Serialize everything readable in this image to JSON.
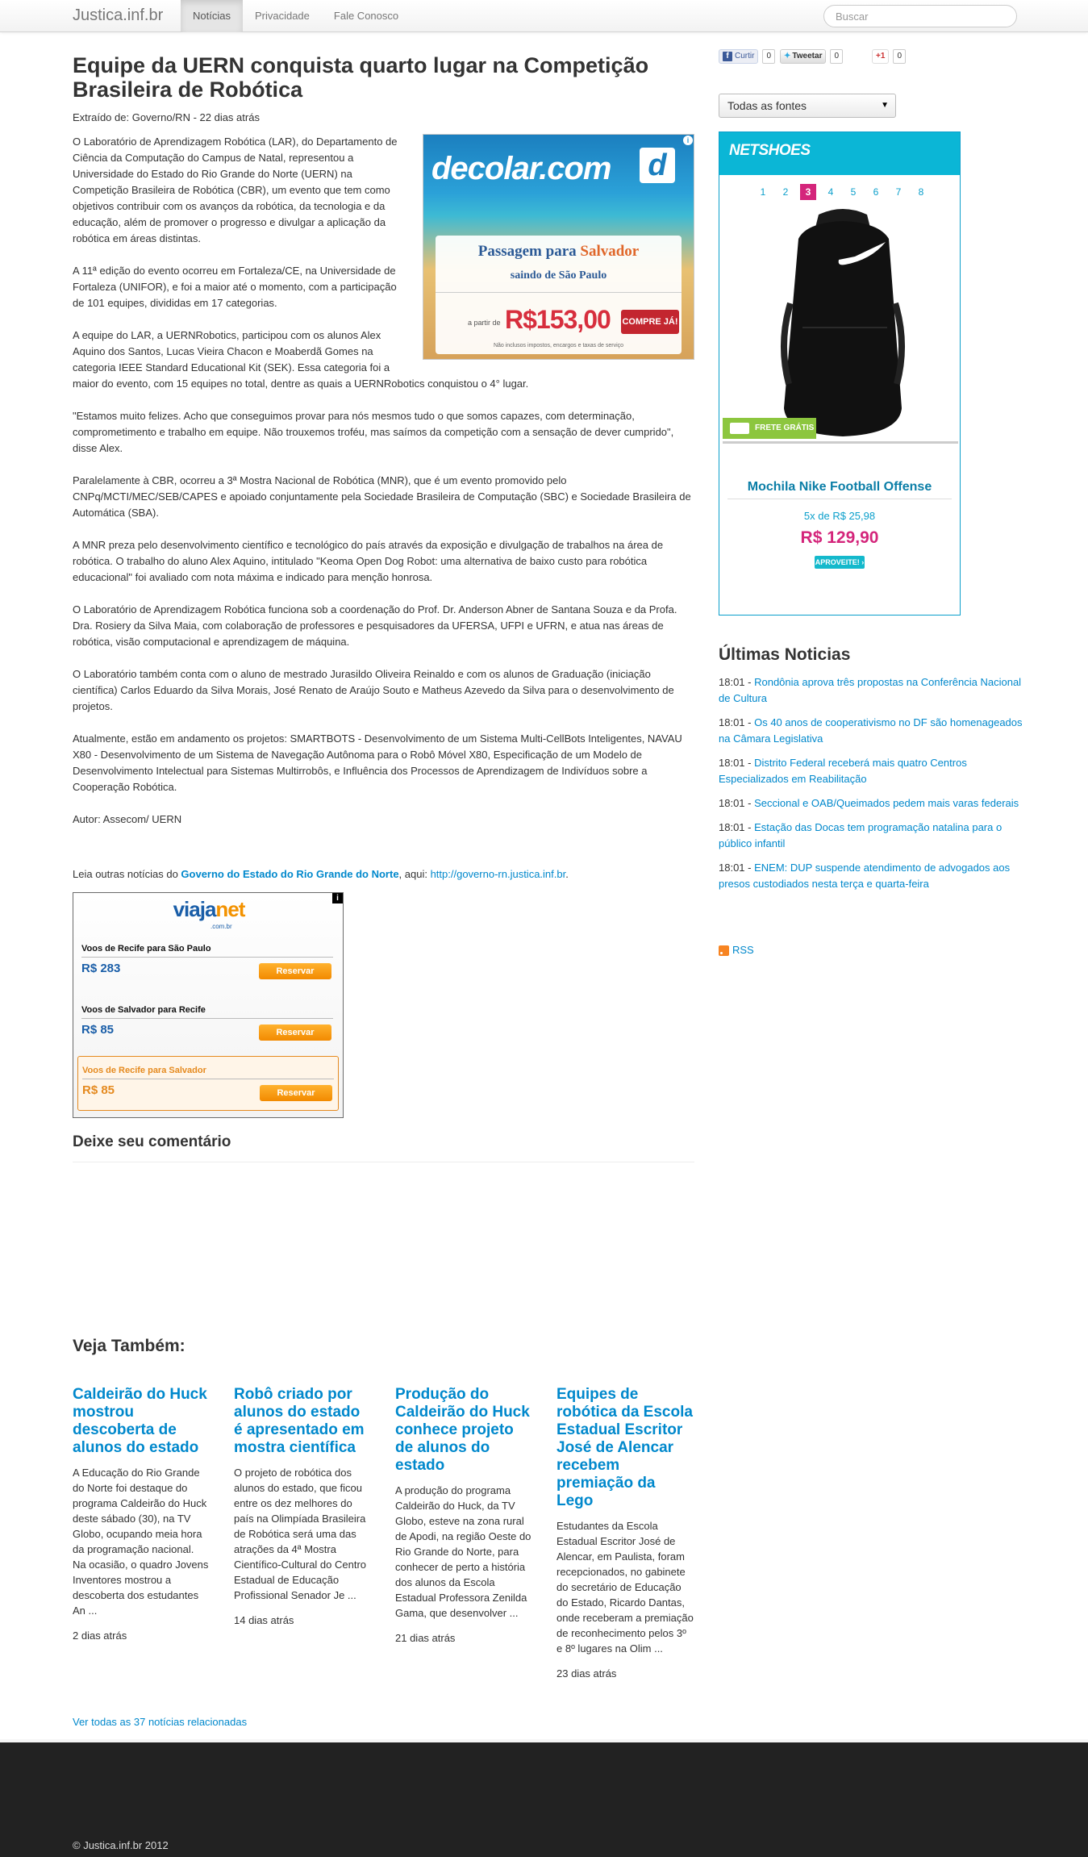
{
  "navbar": {
    "brand": "Justica.inf.br",
    "items": [
      {
        "label": "Notícias"
      },
      {
        "label": "Privacidade"
      },
      {
        "label": "Fale Conosco"
      }
    ],
    "search_placeholder": "Buscar"
  },
  "article": {
    "title": "Equipe da UERN conquista quarto lugar na Competição Brasileira de Robótica",
    "source": "Extraído de: Governo/RN - 22 dias atrás",
    "paragraphs": [
      "O Laboratório de Aprendizagem Robótica (LAR), do Departamento de Ciência da Computação do Campus de Natal, representou a Universidade do Estado do Rio Grande do Norte (UERN) na Competição Brasileira de Robótica (CBR), um evento que tem como objetivos contribuir com os avanços da robótica, da tecnologia e da educação, além de promover o progresso e divulgar a aplicação da robótica em áreas distintas.",
      "A 11ª edição do evento ocorreu em Fortaleza/CE, na Universidade de Fortaleza (UNIFOR), e foi a maior até o momento, com a participação de 101 equipes, divididas em 17 categorias.",
      "A equipe do LAR, a UERNRobotics, participou com os alunos Alex Aquino dos Santos, Lucas Vieira Chacon e Moaberdã Gomes na categoria IEEE Standard Educational Kit (SEK). Essa categoria foi a maior do evento, com 15 equipes no total, dentre as quais a UERNRobotics conquistou o 4° lugar.",
      "\"Estamos muito felizes. Acho que conseguimos provar para nós mesmos tudo o que somos capazes, com determinação, comprometimento e trabalho em equipe. Não trouxemos troféu, mas saímos da competição com a sensação de dever cumprido\", disse Alex.",
      "Paralelamente à CBR, ocorreu a 3ª Mostra Nacional de Robótica (MNR), que é um evento promovido pelo CNPq/MCTI/MEC/SEB/CAPES e apoiado conjuntamente pela Sociedade Brasileira de Computação (SBC) e Sociedade Brasileira de Automática (SBA).",
      "A MNR preza pelo desenvolvimento científico e tecnológico do país através da exposição e divulgação de trabalhos na área de robótica. O trabalho do aluno Alex Aquino, intitulado \"Keoma Open Dog Robot: uma alternativa de baixo custo para robótica educacional\" foi avaliado com nota máxima e indicado para menção honrosa.",
      "O Laboratório de Aprendizagem Robótica funciona sob a coordenação do Prof. Dr. Anderson Abner de Santana Souza e da Profa. Dra. Rosiery da Silva Maia, com colaboração de professores e pesquisadores da UFERSA, UFPI e UFRN, e atua nas áreas de robótica, visão computacional e aprendizagem de máquina.",
      "O Laboratório também conta com o aluno de mestrado Jurasildo Oliveira Reinaldo e com os alunos de Graduação (iniciação científica) Carlos Eduardo da Silva Morais, José Renato de Araújo Souto e Matheus Azevedo da Silva para o desenvolvimento de projetos.",
      "Atualmente, estão em andamento os projetos: SMARTBOTS - Desenvolvimento de um Sistema Multi-CellBots Inteligentes, NAVAU X80 - Desenvolvimento de um Sistema de Navegação Autônoma para o Robô Móvel X80, Especificação de um Modelo de Desenvolvimento Intelectual para Sistemas Multirrobôs, e Influência dos Processos de Aprendizagem de Indivíduos sobre a Cooperação Robótica.",
      "Autor: Assecom/ UERN"
    ],
    "related": {
      "prefix": "Leia outras notícias do ",
      "org": "Governo do Estado do Rio Grande do Norte",
      "middle": ", aqui: ",
      "url": "http://governo-rn.justica.inf.br",
      "suffix": "."
    }
  },
  "ad_decolar": {
    "logo": "decolar.com",
    "info": "i",
    "line1_a": "Passagem para ",
    "line1_b": "Salvador",
    "line2": "saindo de São Paulo",
    "from": "a partir de",
    "price": "R$153,00",
    "button": "COMPRE JÁ!",
    "fine": "Não inclusos impostos, encargos e taxas de serviço"
  },
  "ad_viajanet": {
    "logo_a": "viaja",
    "logo_b": "net",
    "sub": ".com.br",
    "offers": [
      {
        "route": "Voos de Recife para São Paulo",
        "price": "R$ 283",
        "button": "Reservar"
      },
      {
        "route": "Voos de Salvador para Recife",
        "price": "R$ 85",
        "button": "Reservar"
      },
      {
        "route": "Voos de Recife para Salvador",
        "price": "R$ 85",
        "button": "Reservar"
      }
    ]
  },
  "comments": {
    "heading": "Deixe seu comentário"
  },
  "veja": {
    "heading": "Veja Também:",
    "items": [
      {
        "title": "Caldeirão do Huck mostrou descoberta de alunos do estado",
        "text": "A Educação do Rio Grande do Norte foi destaque do programa Caldeirão do Huck deste sábado (30), na TV Globo, ocupando meia hora da programação nacional. Na ocasião, o quadro Jovens Inventores mostrou a descoberta dos estudantes An ...",
        "date": "2 dias atrás"
      },
      {
        "title": "Robô criado por alunos do estado é apresentado em mostra científica",
        "text": "O projeto de robótica dos alunos do estado, que ficou entre os dez melhores do país na Olimpíada Brasileira de Robótica será uma das atrações da 4ª Mostra Científico-Cultural do Centro Estadual de Educação Profissional Senador Je ...",
        "date": "14 dias atrás"
      },
      {
        "title": "Produção do Caldeirão do Huck conhece projeto de alunos do estado",
        "text": "A produção do programa Caldeirão do Huck, da TV Globo, esteve na zona rural de Apodi, na região Oeste do Rio Grande do Norte, para conhecer de perto a história dos alunos da Escola Estadual Professora Zenilda Gama, que desenvolver ...",
        "date": "21 dias atrás"
      },
      {
        "title": "Equipes de robótica da Escola Estadual Escritor José de Alencar recebem premiação da Lego",
        "text": "Estudantes da Escola Estadual Escritor José de Alencar, em Paulista, foram recepcionados, no gabinete do secretário de Educação do Estado, Ricardo Dantas, onde receberam a premiação de reconhecimento pelos 3º e 8º lugares na Olim ...",
        "date": "23 dias atrás"
      }
    ],
    "see_all": "Ver todas as 37 notícias relacionadas"
  },
  "sidebar": {
    "social": {
      "fb_label": "Curtir",
      "fb_count": "0",
      "tw_label": "Tweetar",
      "tw_count": "0",
      "gp_label": "+1",
      "gp_count": "0"
    },
    "select_value": "Todas as fontes",
    "news_heading": "Últimas Noticias",
    "news": [
      {
        "time": "18:01 - ",
        "title": "Rondônia aprova três propostas na Conferência Nacional de Cultura"
      },
      {
        "time": "18:01 - ",
        "title": "Os 40 anos de cooperativismo no DF são homenageados na Câmara Legislativa"
      },
      {
        "time": "18:01 - ",
        "title": "Distrito Federal receberá mais quatro Centros Especializados em Reabilitação"
      },
      {
        "time": "18:01 - ",
        "title": "Seccional e OAB/Queimados pedem mais varas federais"
      },
      {
        "time": "18:01 - ",
        "title": "Estação das Docas tem programação natalina para o público infantil"
      },
      {
        "time": "18:01 - ",
        "title": "ENEM: DUP suspende atendimento de advogados aos presos custodiados nesta terça e quarta-feira"
      }
    ],
    "rss": "RSS"
  },
  "ad_netshoes": {
    "logo": "NETSHOES",
    "pages": [
      "1",
      "2",
      "3",
      "4",
      "5",
      "6",
      "7",
      "8"
    ],
    "active_page": "3",
    "frete": "FRETE GRÁTIS",
    "name": "Mochila Nike Football Offense",
    "installments": "5x de R$ 25,98",
    "price": "R$ 129,90",
    "button": "APROVEITE! ›"
  },
  "footer": {
    "copyright": "© Justica.inf.br 2012"
  },
  "colors": {
    "link": "#0088cc",
    "netshoes_pink": "#d4257b",
    "netshoes_blue": "#0bb6d6",
    "footer_bg": "#222222"
  }
}
